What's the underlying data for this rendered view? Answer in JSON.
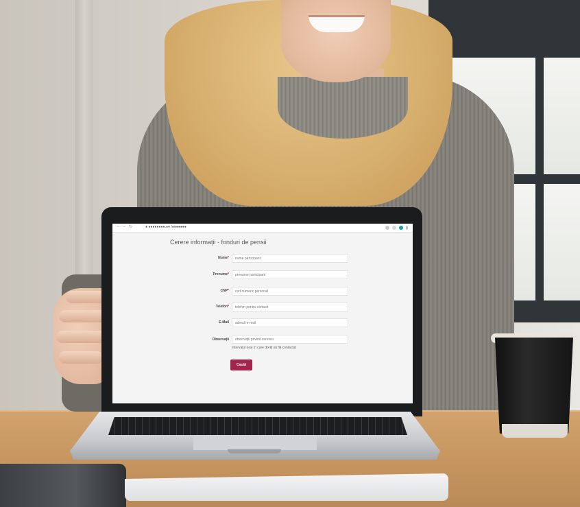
{
  "browser": {
    "url": "●   ●●●●●●●●.●● /●●●●●●●"
  },
  "form": {
    "title": "Cerere informații - fonduri de pensii",
    "required_marker": "*",
    "fields": [
      {
        "label": "Nume",
        "required": true,
        "placeholder": "nume participant"
      },
      {
        "label": "Prenume",
        "required": true,
        "placeholder": "prenume participant"
      },
      {
        "label": "CNP",
        "required": true,
        "placeholder": "cod numeric personal"
      },
      {
        "label": "Telefon",
        "required": true,
        "placeholder": "telefon pentru contact"
      },
      {
        "label": "E-Mail",
        "required": false,
        "placeholder": "adresă e-mail"
      },
      {
        "label": "Observații",
        "required": false,
        "placeholder": "observații privind cererea"
      }
    ],
    "hint": "Intervalul orar in care doriți să fiți contactat",
    "submit_label": "Caută"
  },
  "colors": {
    "accent": "#a3244c",
    "screen_bg": "#f4f4f4",
    "browser_profile_dot": "#1aa0b8"
  }
}
